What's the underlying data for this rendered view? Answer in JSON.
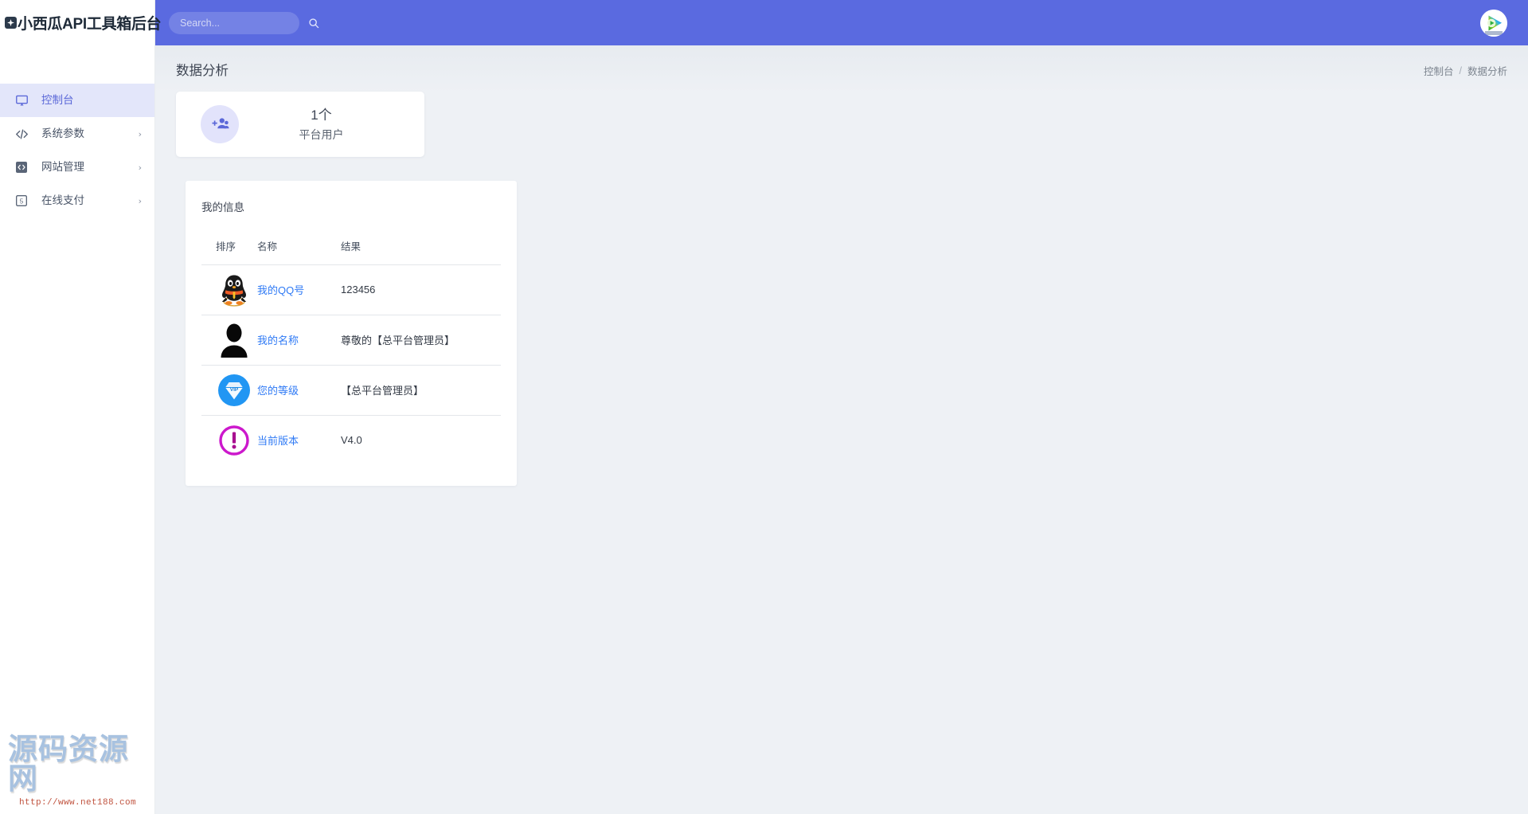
{
  "brand": {
    "logo_icon": "star-badge-icon",
    "title": "小西瓜API工具箱后台"
  },
  "sidebar": {
    "items": [
      {
        "label": "控制台",
        "icon": "monitor-icon",
        "active": true,
        "has_caret": false,
        "caret": ""
      },
      {
        "label": "系统参数",
        "icon": "code-icon",
        "active": false,
        "has_caret": true,
        "caret": "›"
      },
      {
        "label": "网站管理",
        "icon": "code-box-icon",
        "active": false,
        "has_caret": true,
        "caret": "›"
      },
      {
        "label": "在线支付",
        "icon": "money-box-icon",
        "active": false,
        "has_caret": true,
        "caret": "›"
      }
    ]
  },
  "topbar": {
    "search": {
      "placeholder": "Search...",
      "value": "",
      "icon": "search-icon"
    },
    "avatar": {
      "name": "user-avatar",
      "icon": "play-triangle-icon"
    },
    "background_color": "#5a6ae0"
  },
  "page": {
    "title": "数据分析",
    "breadcrumb": {
      "items": [
        "控制台",
        "数据分析"
      ],
      "separator": "/"
    }
  },
  "stat_card": {
    "icon": "add-users-icon",
    "value": "1个",
    "label": "平台用户"
  },
  "info_card": {
    "title": "我的信息",
    "columns": [
      "排序",
      "名称",
      "结果"
    ],
    "rows": [
      {
        "icon": "qq-penguin-icon",
        "name": "我的QQ号",
        "value": "123456"
      },
      {
        "icon": "person-silhouette-icon",
        "name": "我的名称",
        "value": "尊敬的【总平台管理员】"
      },
      {
        "icon": "vip-diamond-icon",
        "name": "您的等级",
        "value": "【总平台管理员】"
      },
      {
        "icon": "exclamation-circle-icon",
        "name": "当前版本",
        "value": "V4.0"
      }
    ]
  },
  "watermark": {
    "text": "源码资源网",
    "url": "http://www.net188.com"
  },
  "colors": {
    "accent": "#5a6ae0",
    "sidebar_active_bg": "#e3e6fa",
    "sidebar_active_text": "#5b68d8",
    "link": "#2f7af5",
    "content_bg": "#eef1f5"
  }
}
